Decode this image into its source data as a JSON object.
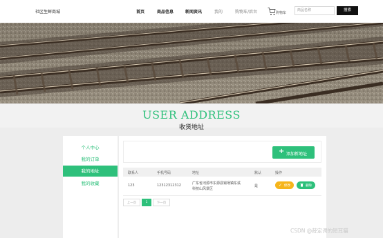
{
  "header": {
    "brand": "社区生鲜商城",
    "nav": [
      "首页",
      "商品信息",
      "新闻资讯",
      "我的",
      "购物车/后台"
    ],
    "cart_label": "购物车",
    "search_placeholder": "商品名称",
    "search_button": "搜索"
  },
  "title": {
    "en": "USER ADDRESS",
    "cn": "收货地址"
  },
  "sidebar": {
    "items": [
      "个人中心",
      "我的订单",
      "我的地址",
      "我的收藏"
    ],
    "active_index": 2
  },
  "panel": {
    "add_button": "添加新地址",
    "columns": [
      "联系人",
      "手机号码",
      "地址",
      "默认",
      "操作"
    ],
    "rows": [
      {
        "contact": "123",
        "phone": "12312312312",
        "address_line1": "广东省河源市东源县锡场镇东溪",
        "address_line2": "科技山风景区",
        "default": "是",
        "edit": "修改",
        "delete": "删除"
      }
    ]
  },
  "pagination": {
    "prev": "上一页",
    "current": "1",
    "next": "下一页"
  },
  "watermark": "CSDN @薛定谔的短耳猫",
  "colors": {
    "accent": "#2ec07b",
    "edit": "#f6b51b",
    "search_button": "#111111"
  },
  "icons": [
    "cart-icon",
    "plus-icon",
    "edit-check-icon",
    "trash-icon"
  ]
}
